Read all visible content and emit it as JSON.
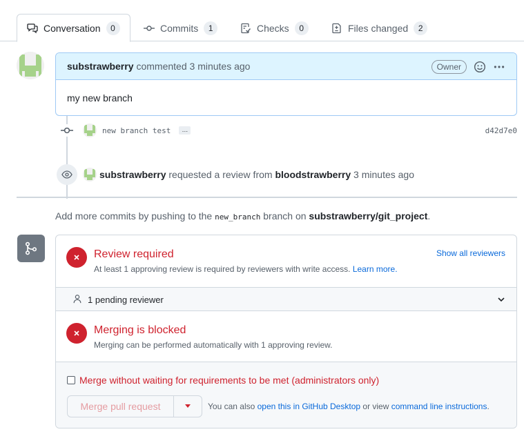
{
  "tabs": [
    {
      "label": "Conversation",
      "count": "0",
      "icon": "comment-discussion-icon"
    },
    {
      "label": "Commits",
      "count": "1",
      "icon": "git-commit-icon"
    },
    {
      "label": "Checks",
      "count": "0",
      "icon": "checklist-icon"
    },
    {
      "label": "Files changed",
      "count": "2",
      "icon": "file-diff-icon"
    }
  ],
  "comment": {
    "author": "substrawberry",
    "action": "commented 3 minutes ago",
    "badge": "Owner",
    "body": "my new branch"
  },
  "commit": {
    "message": "new branch test",
    "ellipsis": "…",
    "sha": "d42d7e0"
  },
  "review_event": {
    "actor": "substrawberry",
    "text": "requested a review from",
    "reviewer": "bloodstrawberry",
    "time": "3 minutes ago"
  },
  "push_note": {
    "prefix": "Add more commits by pushing to the",
    "branch": "new_branch",
    "middle": "branch on",
    "repo": "substrawberry/git_project",
    "suffix": "."
  },
  "review_required": {
    "title": "Review required",
    "desc": "At least 1 approving review is required by reviewers with write access.",
    "learn_more": "Learn more.",
    "show_all": "Show all reviewers"
  },
  "pending": {
    "label": "1 pending reviewer"
  },
  "merging_blocked": {
    "title": "Merging is blocked",
    "desc": "Merging can be performed automatically with 1 approving review."
  },
  "merge_controls": {
    "checkbox_label": "Merge without waiting for requirements to be met (administrators only)",
    "button_label": "Merge pull request",
    "also_prefix": "You can also",
    "desktop_link": "open this in GitHub Desktop",
    "also_middle": "or view",
    "cli_link": "command line instructions",
    "also_suffix": "."
  },
  "colors": {
    "danger": "#cf222e",
    "link": "#0969da",
    "comment_header": "#ddf4ff"
  }
}
